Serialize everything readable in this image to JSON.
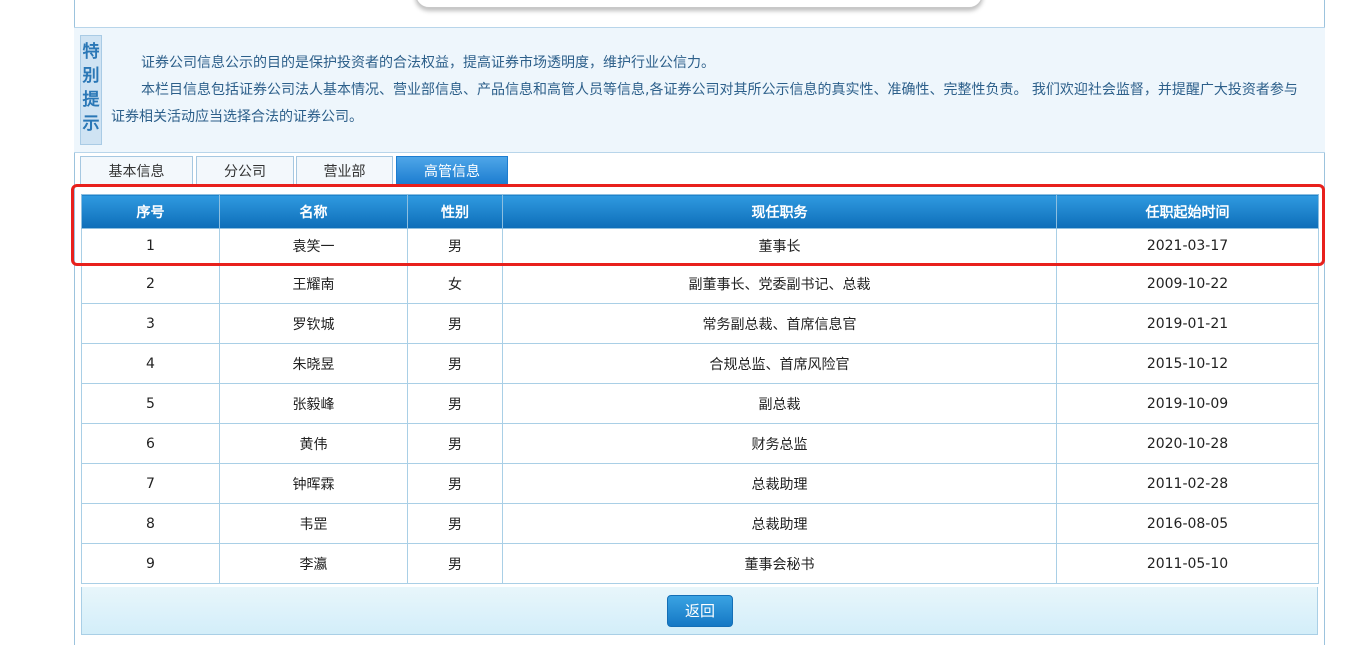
{
  "notice": {
    "badge": [
      "特",
      "别",
      "提",
      "示"
    ],
    "line1": "证券公司信息公示的目的是保护投资者的合法权益，提高证券市场透明度，维护行业公信力。",
    "line2": "本栏目信息包括证券公司法人基本情况、营业部信息、产品信息和高管人员等信息,各证券公司对其所公示信息的真实性、准确性、完整性负责。 我们欢迎社会监督，并提醒广大投资者参与证券相关活动应当选择合法的证券公司。"
  },
  "tabs": [
    {
      "label": "基本信息",
      "active": false
    },
    {
      "label": "分公司",
      "active": false
    },
    {
      "label": "营业部",
      "active": false
    },
    {
      "label": "高管信息",
      "active": true
    }
  ],
  "table": {
    "headers": [
      "序号",
      "名称",
      "性别",
      "现任职务",
      "任职起始时间"
    ],
    "rows": [
      [
        "1",
        "袁笑一",
        "男",
        "董事长",
        "2021-03-17"
      ],
      [
        "2",
        "王耀南",
        "女",
        "副董事长、党委副书记、总裁",
        "2009-10-22"
      ],
      [
        "3",
        "罗钦城",
        "男",
        "常务副总裁、首席信息官",
        "2019-01-21"
      ],
      [
        "4",
        "朱晓昱",
        "男",
        "合规总监、首席风险官",
        "2015-10-12"
      ],
      [
        "5",
        "张毅峰",
        "男",
        "副总裁",
        "2019-10-09"
      ],
      [
        "6",
        "黄伟",
        "男",
        "财务总监",
        "2020-10-28"
      ],
      [
        "7",
        "钟晖霖",
        "男",
        "总裁助理",
        "2011-02-28"
      ],
      [
        "8",
        "韦罡",
        "男",
        "总裁助理",
        "2016-08-05"
      ],
      [
        "9",
        "李瀛",
        "男",
        "董事会秘书",
        "2011-05-10"
      ]
    ]
  },
  "footer": {
    "back_label": "返回"
  },
  "colors": {
    "accent": "#1d7dd0",
    "highlight": "#e8201c",
    "notice_text": "#2c5f8a"
  }
}
